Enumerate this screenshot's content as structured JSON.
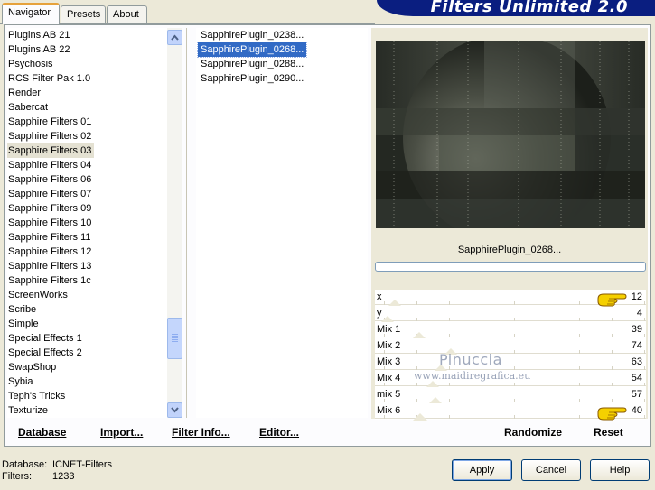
{
  "tabs": [
    {
      "label": "Navigator"
    },
    {
      "label": "Presets"
    },
    {
      "label": "About"
    }
  ],
  "banner": {
    "title": "Filters Unlimited 2.0"
  },
  "categories": [
    "Plugins AB 21",
    "Plugins AB 22",
    "Psychosis",
    "RCS Filter Pak 1.0",
    "Render",
    "Sabercat",
    "Sapphire Filters 01",
    "Sapphire Filters 02",
    "Sapphire Filters 03",
    "Sapphire Filters 04",
    "Sapphire Filters 06",
    "Sapphire Filters 07",
    "Sapphire Filters 09",
    "Sapphire Filters 10",
    "Sapphire Filters 11",
    "Sapphire Filters 12",
    "Sapphire Filters 13",
    "Sapphire Filters 1c",
    "ScreenWorks",
    "Scribe",
    "Simple",
    "Special Effects 1",
    "Special Effects 2",
    "SwapShop",
    "Sybia",
    "Teph's Tricks",
    "Texturize"
  ],
  "selected_category": "Sapphire Filters 03",
  "filters": [
    "SapphirePlugin_0238...",
    "SapphirePlugin_0268...",
    "SapphirePlugin_0288...",
    "SapphirePlugin_0290..."
  ],
  "selected_filter": "SapphirePlugin_0268...",
  "preview_name": "SapphirePlugin_0268...",
  "progress": 0,
  "params": [
    {
      "name": "x",
      "value": "12",
      "level": 0.047
    },
    {
      "name": "y",
      "value": "4",
      "level": 0.016
    },
    {
      "name": "Mix 1",
      "value": "39",
      "level": 0.153
    },
    {
      "name": "Mix 2",
      "value": "74",
      "level": 0.29
    },
    {
      "name": "Mix 3",
      "value": "63",
      "level": 0.247
    },
    {
      "name": "Mix 4",
      "value": "54",
      "level": 0.212
    },
    {
      "name": "mix 5",
      "value": "57",
      "level": 0.224
    },
    {
      "name": "Mix 6",
      "value": "40",
      "level": 0.157
    }
  ],
  "watermark": {
    "line1": "Pinuccia",
    "line2": "www.maidiregrafica.eu"
  },
  "left_links": {
    "database": "Database",
    "import": "Import...",
    "filter_info": "Filter Info...",
    "editor": "Editor..."
  },
  "right_links": {
    "randomize": "Randomize",
    "reset": "Reset"
  },
  "status": {
    "database_label": "Database:",
    "database_value": "ICNET-Filters",
    "filters_label": "Filters:",
    "filters_value": "1233"
  },
  "buttons": {
    "apply": "Apply",
    "cancel": "Cancel",
    "help": "Help"
  },
  "colors": {
    "selection": "#316ac5",
    "banner": "#0a1e80",
    "face": "#ece9d8"
  }
}
